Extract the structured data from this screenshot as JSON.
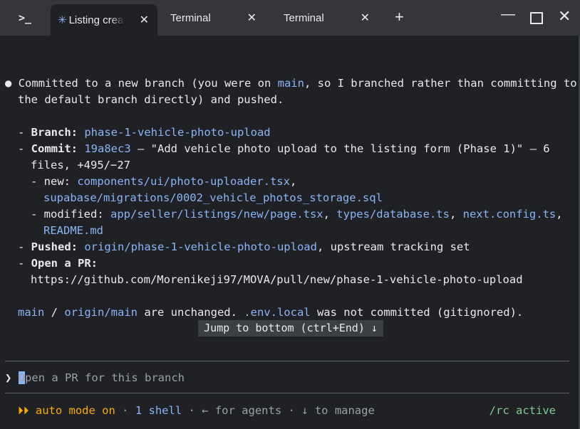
{
  "tabs": [
    {
      "label": "Listing creating",
      "active": true,
      "icon": "spinner-icon"
    },
    {
      "label": "Terminal"
    },
    {
      "label": "Terminal"
    }
  ],
  "output": {
    "bullet": "●",
    "l1_a": "Committed to a new branch (you were on ",
    "l1_main": "main",
    "l1_b": ", so I branched rather than committing to",
    "l2": "the default branch directly) and pushed.",
    "branch_key": "Branch:",
    "branch_val": "phase-1-vehicle-photo-upload",
    "commit_key": "Commit:",
    "commit_hash": "19a8ec3",
    "commit_msg": " — \"Add vehicle photo upload to the listing form (Phase 1)\" — 6",
    "commit_stats": "files, +495/−27",
    "new_label": "new: ",
    "new_1": "components/ui/photo-uploader.tsx",
    "new_2": "supabase/migrations/0002_vehicle_photos_storage.sql",
    "mod_label": "modified: ",
    "mod_1": "app/seller/listings/new/page.tsx",
    "mod_2": "types/database.ts",
    "mod_3": "next.config.ts",
    "mod_4": "README.md",
    "pushed_key": "Pushed:",
    "pushed_val": "origin/phase-1-vehicle-photo-upload",
    "pushed_tail": ", upstream tracking set",
    "pr_key": "Open a PR:",
    "pr_url": "https://github.com/Morenikeji97/MOVA/pull/new/phase-1-vehicle-photo-upload",
    "f_main": "main",
    "f_sep": " / ",
    "f_origin": "origin/main",
    "f_a": " are unchanged. ",
    "f_env": ".env.local",
    "f_b": " was not committed (gitignored)."
  },
  "jump_label": "Jump to bottom (ctrl+End) ↓",
  "input": {
    "prompt": "❯",
    "placeholder_first": "O",
    "placeholder_rest": "pen a PR for this branch"
  },
  "status": {
    "mode_icon": "⏵⏵",
    "mode": "auto mode on",
    "dot": " · ",
    "shells": "1 shell",
    "agents": "← for agents",
    "manage": "↓ to manage",
    "right": "/rc active"
  },
  "colors": {
    "accent": "#8ab4f8",
    "yellow": "#f9ab00",
    "green": "#81c995",
    "bg": "#202124"
  }
}
